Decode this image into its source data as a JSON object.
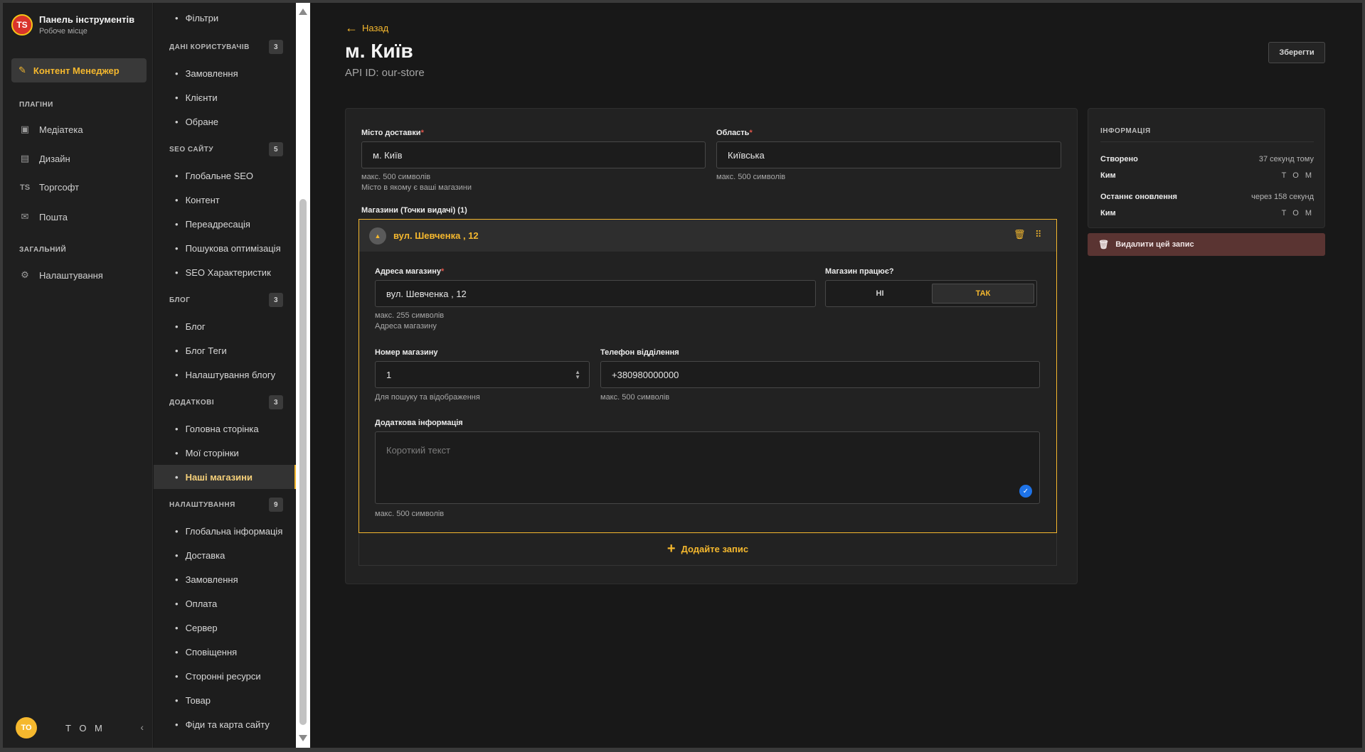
{
  "brand": {
    "logo_text": "TS",
    "title": "Панель інструментів",
    "subtitle": "Робоче місце"
  },
  "mainnav": {
    "active_label": "Контент Менеджер",
    "sections": {
      "plugins": "ПЛАГІНИ",
      "general": "ЗАГАЛЬНИЙ"
    },
    "items": {
      "media": "Медіатека",
      "design": "Дизайн",
      "torgsoft": "Торгсофт",
      "mail": "Пошта",
      "settings": "Налаштування"
    }
  },
  "user": {
    "initials": "TO",
    "name": "T O M"
  },
  "subnav": {
    "top_item": "Фільтри",
    "groups": [
      {
        "title": "ДАНІ КОРИСТУВАЧІВ",
        "count": "3",
        "items": [
          "Замовлення",
          "Клієнти",
          "Обране"
        ]
      },
      {
        "title": "SEO САЙТУ",
        "count": "5",
        "items": [
          "Глобальне SEO",
          "Контент",
          "Переадресація",
          "Пошукова оптимізація",
          "SEO Характеристик"
        ]
      },
      {
        "title": "БЛОГ",
        "count": "3",
        "items": [
          "Блог",
          "Блог Теги",
          "Налаштування блогу"
        ]
      },
      {
        "title": "ДОДАТКОВІ",
        "count": "3",
        "items": [
          "Головна сторінка",
          "Мої сторінки",
          "Наші магазини"
        ]
      },
      {
        "title": "НАЛАШТУВАННЯ",
        "count": "9",
        "items": [
          "Глобальна інформація",
          "Доставка",
          "Замовлення",
          "Оплата",
          "Сервер",
          "Сповіщення",
          "Сторонні ресурси",
          "Товар",
          "Фіди та карта сайту"
        ]
      }
    ]
  },
  "header": {
    "back": "Назад",
    "title": "м. Київ",
    "api_id": "API ID: our-store",
    "save": "Зберегти"
  },
  "form": {
    "city_label": "Місто доставки",
    "city_value": "м. Київ",
    "city_hint1": "макс. 500 символів",
    "city_hint2": "Місто в якому є ваші магазини",
    "region_label": "Область",
    "region_value": "Київська",
    "region_hint": "макс. 500 символів",
    "stores_label": "Магазини (Точки видачі) (1)",
    "required_mark": "*"
  },
  "store": {
    "head_title": "вул. Шевченка , 12",
    "address_label": "Адреса магазину",
    "address_value": "вул. Шевченка , 12",
    "address_hint1": "макс. 255 символів",
    "address_hint2": "Адреса магазину",
    "works_label": "Магазин працює?",
    "works_no": "НІ",
    "works_yes": "ТАК",
    "number_label": "Номер магазину",
    "number_value": "1",
    "number_hint": "Для пошуку та відображення",
    "phone_label": "Телефон відділення",
    "phone_value": "+380980000000",
    "phone_hint": "макс. 500 символів",
    "extra_label": "Додаткова інформація",
    "extra_placeholder": "Короткий текст",
    "extra_hint": "макс. 500 символів"
  },
  "add_entry": "Додайте запис",
  "info": {
    "title": "ІНФОРМАЦІЯ",
    "created_label": "Створено",
    "created_value": "37 секунд тому",
    "created_by_label": "Ким",
    "created_by_value": "T O M",
    "updated_label": "Останнє оновлення",
    "updated_value": "через 158 секунд",
    "updated_by_label": "Ким",
    "updated_by_value": "T O M"
  },
  "delete": "Видалити цей запис",
  "colors": {
    "accent": "#f5b82e",
    "danger_bg": "#5a3432",
    "check": "#1e73e8"
  }
}
